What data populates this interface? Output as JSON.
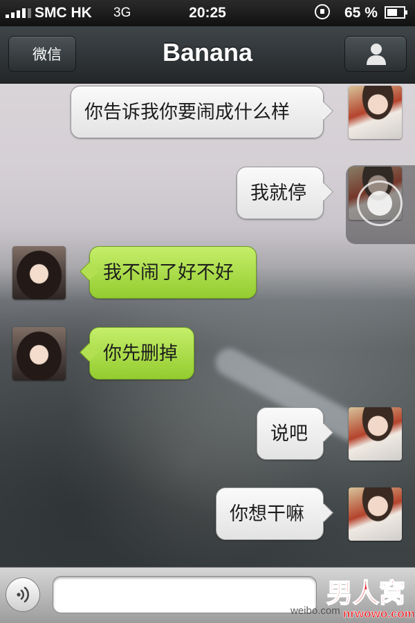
{
  "status_bar": {
    "carrier": "SMC HK",
    "network": "3G",
    "time": "20:25",
    "battery_text": "65 %",
    "battery_level": 0.65
  },
  "nav": {
    "back_label": "微信",
    "title": "Banana",
    "profile_icon": "person-icon"
  },
  "messages": [
    {
      "side": "outgoing",
      "sender": "me",
      "text": "你告诉我你要闹成什么样"
    },
    {
      "side": "outgoing",
      "sender": "me",
      "text": "我就停"
    },
    {
      "side": "incoming",
      "sender": "Banana",
      "text": "我不闹了好不好"
    },
    {
      "side": "incoming",
      "sender": "Banana",
      "text": "你先删掉"
    },
    {
      "side": "outgoing",
      "sender": "me",
      "text": "说吧"
    },
    {
      "side": "outgoing",
      "sender": "me",
      "text": "你想干嘛"
    }
  ],
  "input": {
    "value": "",
    "placeholder": "",
    "voice_icon": "voice-icon"
  },
  "watermark": {
    "weibo": "weibo.com",
    "site_name": "男人窝",
    "site_url": "nrwowo.com"
  },
  "colors": {
    "incoming_bubble": "#a9db49",
    "outgoing_bubble": "#f0f0f0",
    "nav_bar": "#2f3437"
  }
}
